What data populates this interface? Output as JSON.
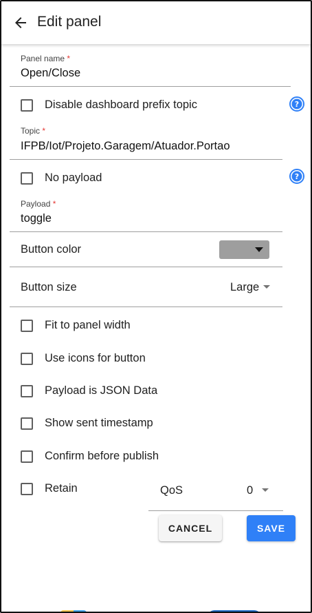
{
  "appbar": {
    "title": "Edit panel",
    "back_icon": "arrow-left-icon"
  },
  "fields": {
    "panel_name": {
      "label": "Panel name",
      "required_mark": "*",
      "value": "Open/Close"
    },
    "topic": {
      "label": "Topic",
      "required_mark": "*",
      "value": "IFPB/Iot/Projeto.Garagem/Atuador.Portao"
    },
    "payload": {
      "label": "Payload",
      "required_mark": "*",
      "value": "toggle"
    }
  },
  "checkboxes": {
    "disable_prefix": {
      "label": "Disable dashboard prefix topic",
      "checked": false
    },
    "no_payload": {
      "label": "No payload",
      "checked": false
    },
    "fit_width": {
      "label": "Fit to panel width",
      "checked": false
    },
    "use_icons": {
      "label": "Use icons for button",
      "checked": false
    },
    "json_data": {
      "label": "Payload is JSON Data",
      "checked": false
    },
    "show_timestamp": {
      "label": "Show sent timestamp",
      "checked": false
    },
    "confirm_publish": {
      "label": "Confirm before publish",
      "checked": false
    },
    "retain": {
      "label": "Retain",
      "checked": false
    }
  },
  "button_color": {
    "label": "Button color",
    "value_color": "#9e9e9e"
  },
  "button_size": {
    "label": "Button size",
    "value": "Large"
  },
  "qos": {
    "label": "QoS",
    "value": "0"
  },
  "actions": {
    "cancel": "CANCEL",
    "save": "SAVE"
  },
  "colors": {
    "accent": "#2f80f7",
    "help": "#2f80f7",
    "required": "#e53935"
  }
}
